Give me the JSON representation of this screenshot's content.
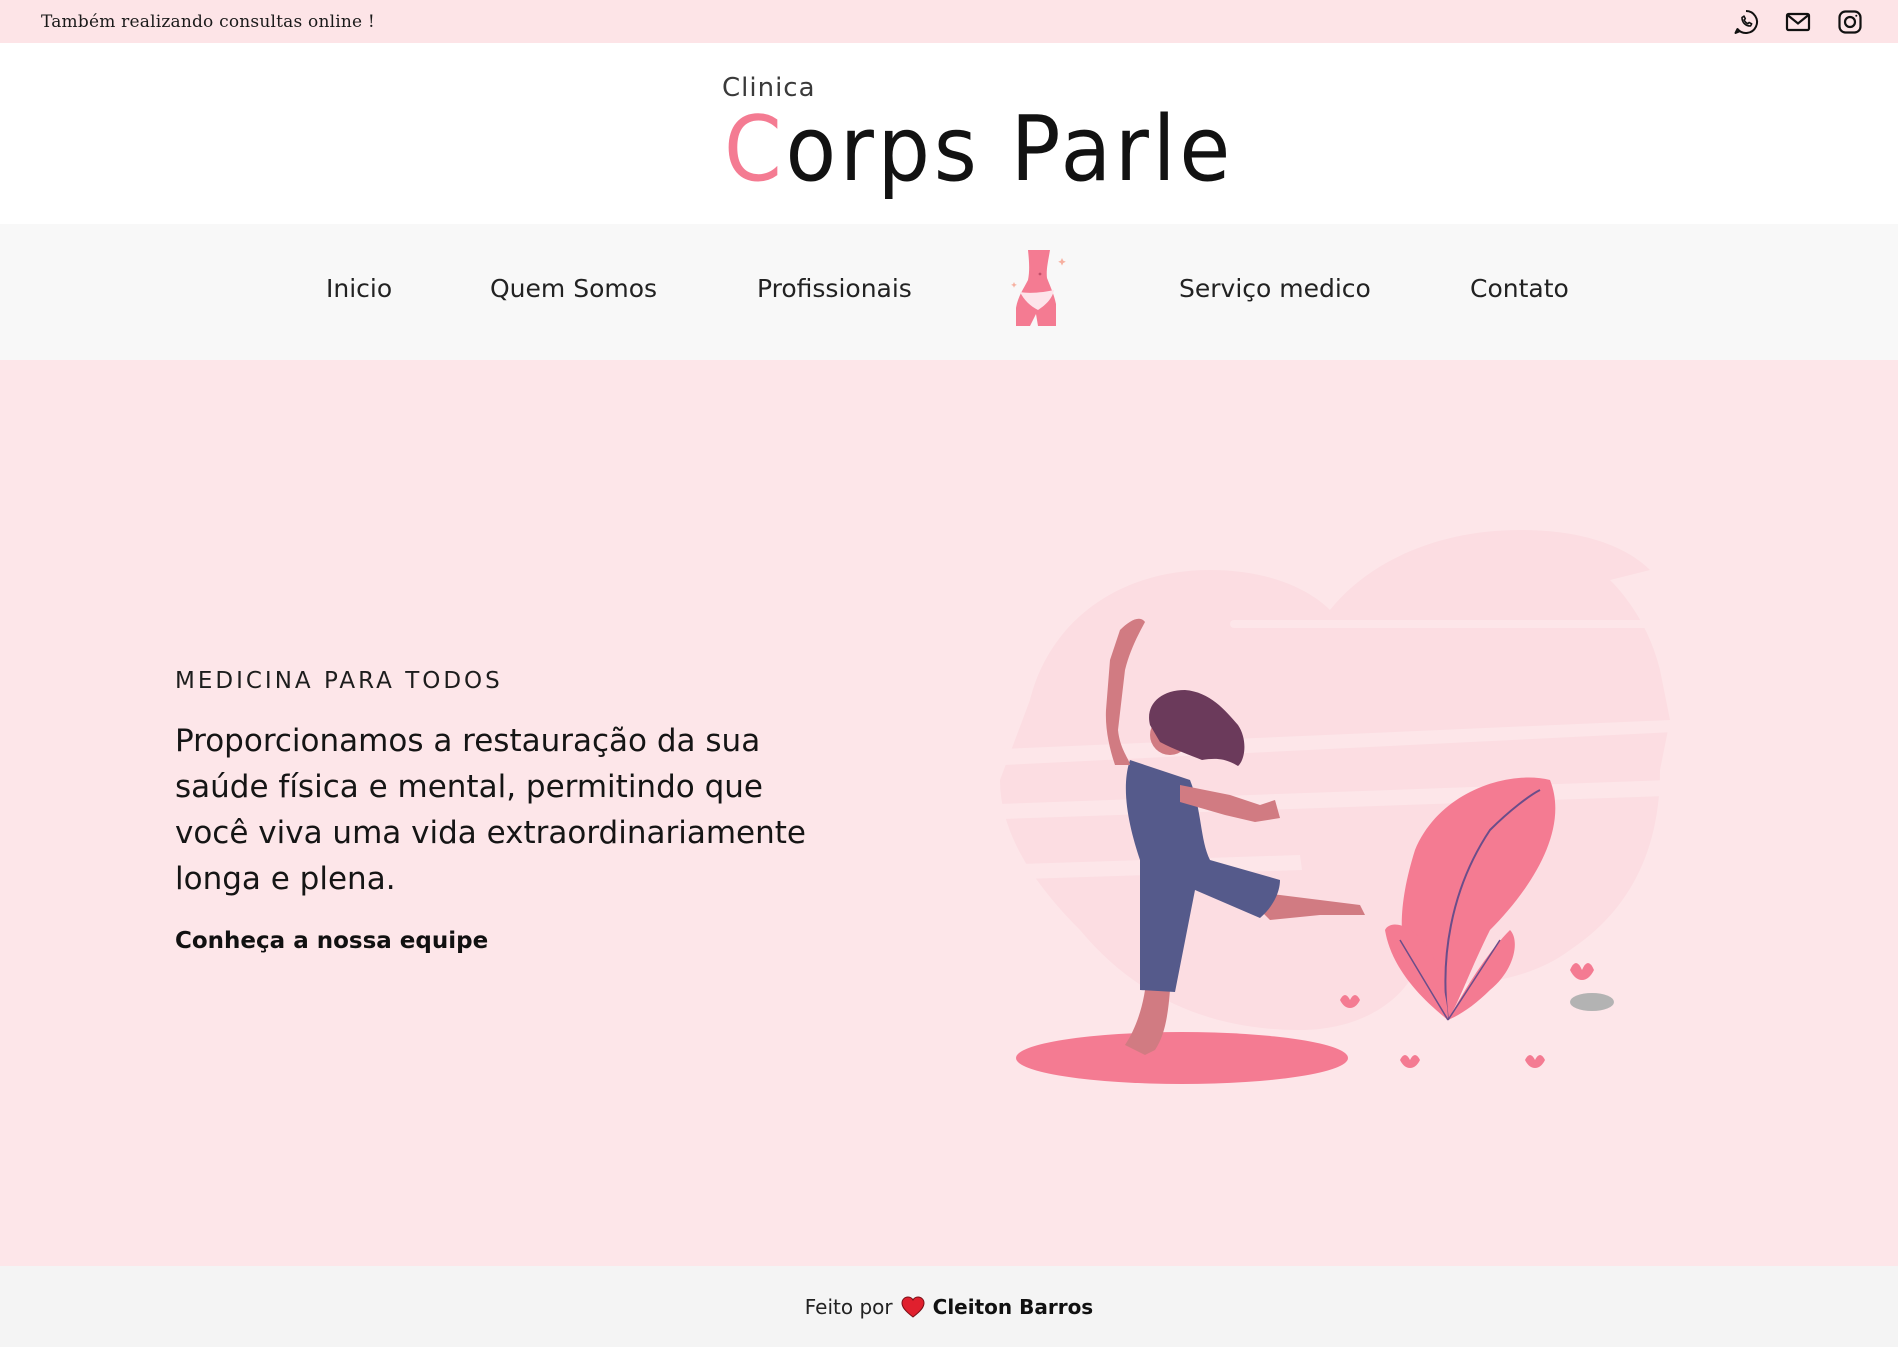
{
  "topbar": {
    "notice": "Também realizando consultas online !",
    "icons": [
      "whatsapp-icon",
      "mail-icon",
      "instagram-icon"
    ]
  },
  "logo": {
    "small": "Clinica",
    "big_accent": "C",
    "big_rest": "orps Parle"
  },
  "nav": {
    "items": [
      {
        "label": "Inicio"
      },
      {
        "label": "Quem Somos"
      },
      {
        "label": "Profissionais"
      },
      {
        "label": "Serviço medico"
      },
      {
        "label": "Contato"
      }
    ],
    "center_icon": "body-silhouette-icon"
  },
  "hero": {
    "kicker": "MEDICINA PARA TODOS",
    "text": "Proporcionamos a restauração da sua saúde física e mental, permitindo que você viva uma vida extraordinariamente longa e plena.",
    "link": "Conheça a nossa equipe",
    "illustration": "dancing-woman-illustration"
  },
  "footer": {
    "prefix": "Feito por",
    "icon": "heart-icon",
    "author": "Cleiton Barros"
  },
  "colors": {
    "topbar_bg": "#fde4e7",
    "hero_bg": "#fde6e9",
    "accent_pink": "#f47b92",
    "nav_bg": "#f8f8f8",
    "footer_bg": "#f4f4f4",
    "heart_red": "#e0202e"
  }
}
